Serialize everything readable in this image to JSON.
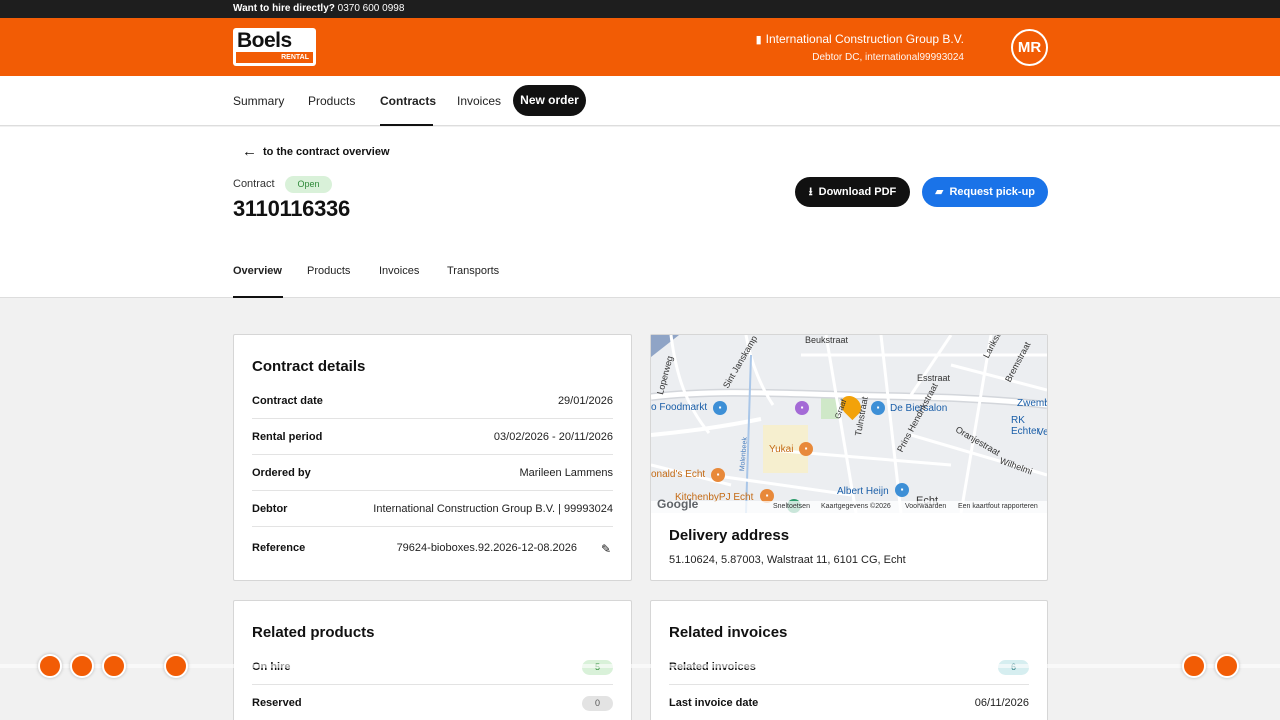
{
  "topbar": {
    "question": "Want to hire directly?",
    "phone": "0370 600 0998"
  },
  "header": {
    "logo_name": "Boels",
    "logo_sub": "RENTAL",
    "company": "International Construction Group B.V.",
    "debtor": "Debtor DC, international99993024",
    "avatar": "MR"
  },
  "nav": {
    "summary": "Summary",
    "products": "Products",
    "contracts": "Contracts",
    "invoices": "Invoices",
    "new_order": "New order"
  },
  "contract": {
    "back_label": "to the contract overview",
    "type_label": "Contract",
    "status": "Open",
    "number": "3110116336",
    "download_pdf": "Download PDF",
    "request_pickup": "Request pick-up"
  },
  "subtabs": {
    "overview": "Overview",
    "products": "Products",
    "invoices": "Invoices",
    "transports": "Transports"
  },
  "details": {
    "title": "Contract details",
    "rows": [
      {
        "label": "Contract date",
        "value": "29/01/2026"
      },
      {
        "label": "Rental period",
        "value": "03/02/2026 - 20/11/2026"
      },
      {
        "label": "Ordered by",
        "value": "Marileen Lammens"
      },
      {
        "label": "Debtor",
        "value": "International Construction Group B.V. | 99993024"
      },
      {
        "label": "Reference",
        "value": "79624-bioboxes.92.2026-12-08.2026"
      }
    ]
  },
  "delivery": {
    "title": "Delivery address",
    "address": "51.10624, 5.87003, Walstraat 11, 6101 CG, Echt",
    "map": {
      "labels": {
        "beukstraat": "Beukstraat",
        "esstraat": "Esstraat",
        "foodmarkt": "o Foodmarkt",
        "de_biersalon": "De Biersalon",
        "zwemb": "Zwemb",
        "rk_echter": "RK Echter",
        "ve": "Ve",
        "yukai": "Yukai",
        "onalds": "onald's Echt",
        "kitchenby": "KitchenbyPJ Echt",
        "albert_heijn": "Albert Heijn",
        "echt": "Echt",
        "wilhelm": "Wilhelmi",
        "oranjestraat": "Oranjestraat",
        "prins_hendrik": "Prins Hendrikstraat",
        "tulnstraat": "Tulnstraat",
        "sint_janskamp": "Sint Janskamp",
        "lopeweg": "Loperweg",
        "bremstraat": "Bremstraat",
        "larikstr": "Larikstr",
        "molenbeek": "Molenbeek",
        "graaf": "Graaf",
        "google": "Google",
        "sneltoetsen": "Sneltoetsen",
        "kaartgegevens": "Kaartgegevens ©2026",
        "voorwaarden": "Voorwaarden",
        "rapporteren": "Een kaartfout rapporteren"
      }
    }
  },
  "related_products": {
    "title": "Related products",
    "rows": [
      {
        "label": "On hire",
        "count": "5"
      },
      {
        "label": "Reserved",
        "count": "0"
      }
    ]
  },
  "related_invoices": {
    "title": "Related invoices",
    "rows": [
      {
        "label": "Related invoices",
        "count": "6"
      },
      {
        "label": "Last invoice date",
        "value": "06/11/2026"
      }
    ]
  },
  "colors": {
    "brand": "#f25c05",
    "primary_blue": "#1a73e8",
    "dark": "#111111"
  }
}
